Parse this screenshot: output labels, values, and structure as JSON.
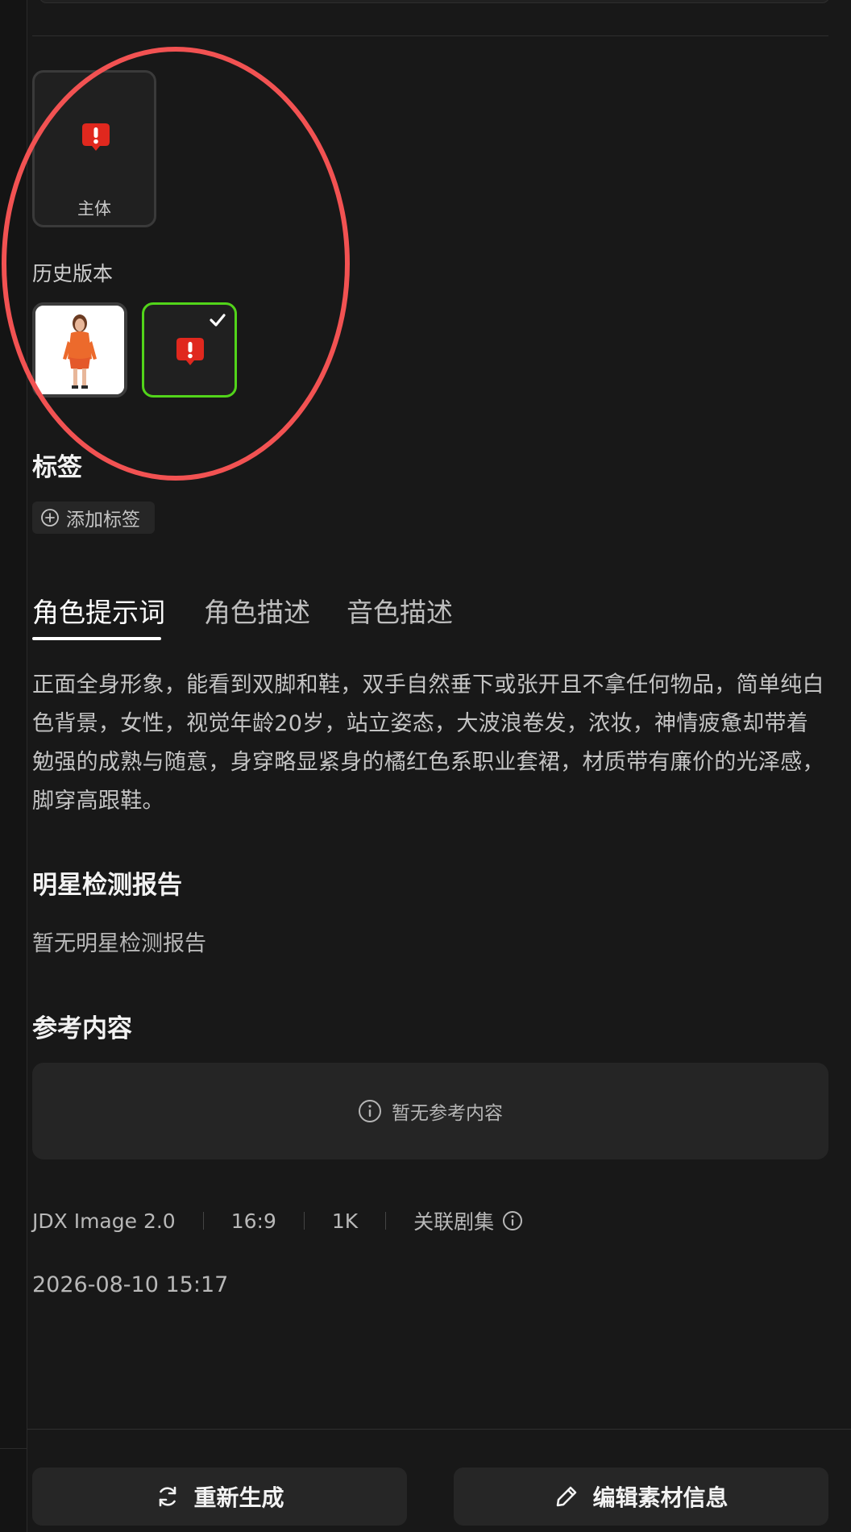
{
  "subject": {
    "label": "主体",
    "icon": "alert-icon",
    "alert_color": "#e0281e"
  },
  "history": {
    "title": "历史版本",
    "versions": [
      {
        "kind": "image",
        "description_icon": "character-thumbnail"
      },
      {
        "kind": "alert",
        "icon": "alert-icon",
        "selected": true,
        "selected_color": "#52d41a"
      }
    ]
  },
  "annotation": {
    "shape": "ellipse",
    "color": "#f25252"
  },
  "tags": {
    "title": "标签",
    "add_label": "添加标签"
  },
  "tabs": {
    "items": [
      {
        "label": "角色提示词",
        "active": true
      },
      {
        "label": "角色描述",
        "active": false
      },
      {
        "label": "音色描述",
        "active": false
      }
    ]
  },
  "prompt": {
    "text": "正面全身形象，能看到双脚和鞋，双手自然垂下或张开且不拿任何物品，简单纯白色背景，女性，视觉年龄20岁，站立姿态，大波浪卷发，浓妆，神情疲惫却带着勉强的成熟与随意，身穿略显紧身的橘红色系职业套裙，材质带有廉价的光泽感，脚穿高跟鞋。"
  },
  "celebrity": {
    "title": "明星检测报告",
    "empty_text": "暂无明星检测报告"
  },
  "reference": {
    "title": "参考内容",
    "empty_text": "暂无参考内容"
  },
  "meta": {
    "model": "JDX Image 2.0",
    "ratio": "16:9",
    "resolution": "1K",
    "linked_label": "关联剧集"
  },
  "timestamp": "2026-08-10 15:17",
  "footer": {
    "regenerate_label": "重新生成",
    "edit_label": "编辑素材信息"
  }
}
